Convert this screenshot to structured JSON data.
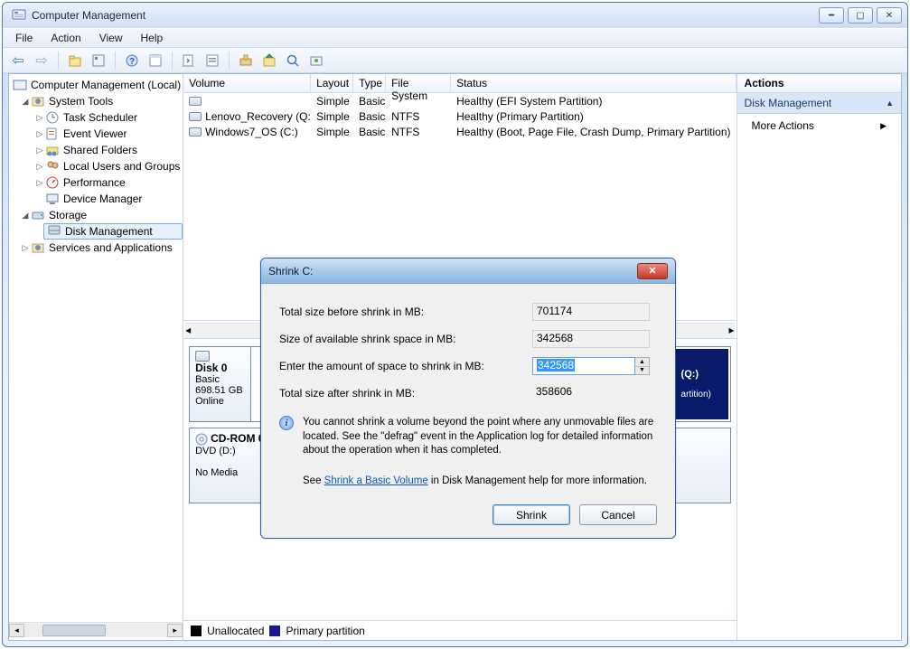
{
  "window": {
    "title": "Computer Management"
  },
  "menu": {
    "file": "File",
    "action": "Action",
    "view": "View",
    "help": "Help"
  },
  "tree": {
    "root": "Computer Management (Local)",
    "system_tools": "System Tools",
    "task_scheduler": "Task Scheduler",
    "event_viewer": "Event Viewer",
    "shared_folders": "Shared Folders",
    "local_users": "Local Users and Groups",
    "performance": "Performance",
    "device_manager": "Device Manager",
    "storage": "Storage",
    "disk_management": "Disk Management",
    "services_apps": "Services and Applications"
  },
  "volumes": {
    "headers": {
      "volume": "Volume",
      "layout": "Layout",
      "type": "Type",
      "fs": "File System",
      "status": "Status"
    },
    "rows": [
      {
        "volume": "",
        "layout": "Simple",
        "type": "Basic",
        "fs": "",
        "status": "Healthy (EFI System Partition)"
      },
      {
        "volume": "Lenovo_Recovery (Q:)",
        "layout": "Simple",
        "type": "Basic",
        "fs": "NTFS",
        "status": "Healthy (Primary Partition)"
      },
      {
        "volume": "Windows7_OS (C:)",
        "layout": "Simple",
        "type": "Basic",
        "fs": "NTFS",
        "status": "Healthy (Boot, Page File, Crash Dump, Primary Partition)"
      }
    ]
  },
  "disks": {
    "disk0": {
      "name": "Disk 0",
      "type": "Basic",
      "size": "698.51 GB",
      "state": "Online"
    },
    "cdrom": {
      "name": "CD-ROM 0",
      "label": "DVD (D:)",
      "state": "No Media"
    },
    "part_q_name": "(Q:)",
    "part_q_status": "artition)"
  },
  "legend": {
    "unallocated": "Unallocated",
    "primary": "Primary partition"
  },
  "actions": {
    "header": "Actions",
    "section": "Disk Management",
    "more_actions": "More Actions"
  },
  "dialog": {
    "title": "Shrink C:",
    "total_before_label": "Total size before shrink in MB:",
    "total_before": "701174",
    "avail_label": "Size of available shrink space in MB:",
    "avail": "342568",
    "enter_label": "Enter the amount of space to shrink in MB:",
    "enter": "342568",
    "total_after_label": "Total size after shrink in MB:",
    "total_after": "358606",
    "info_text": "You cannot shrink a volume beyond the point where any unmovable files are located. See the \"defrag\" event in the Application log for detailed information about the operation when it has completed.",
    "see_prefix": "See ",
    "link": "Shrink a Basic Volume",
    "see_suffix": " in Disk Management help for more information.",
    "shrink_btn": "Shrink",
    "cancel_btn": "Cancel"
  }
}
